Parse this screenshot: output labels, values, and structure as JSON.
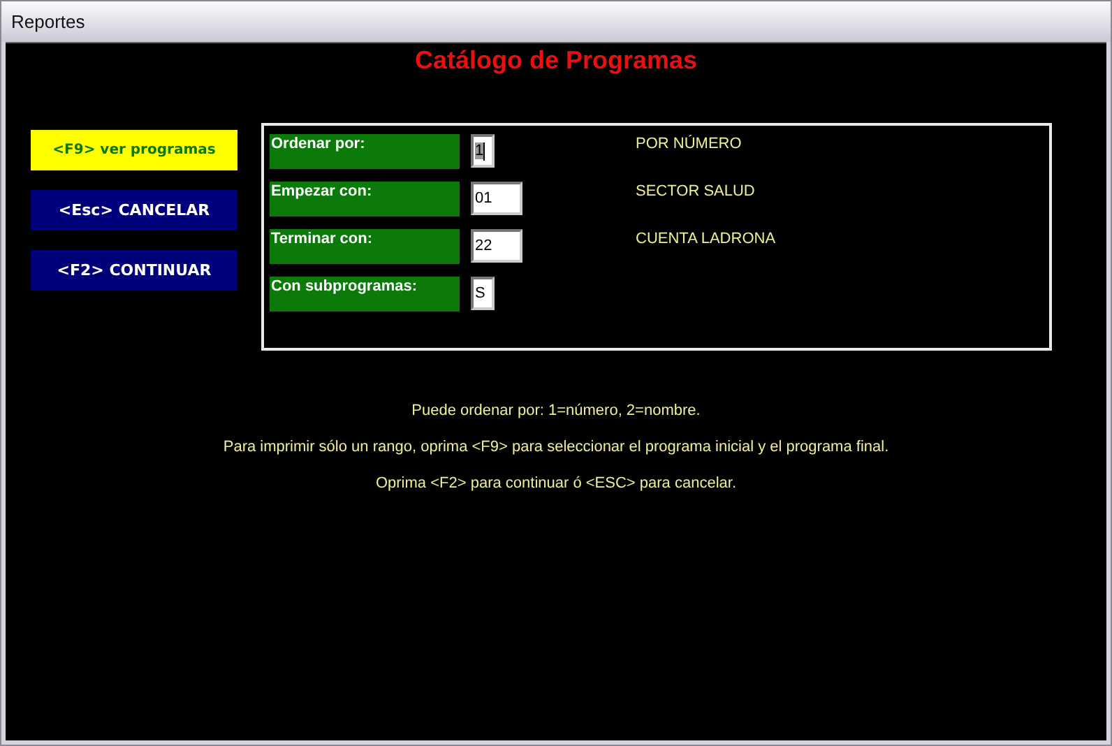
{
  "window": {
    "title": "Reportes"
  },
  "heading": "Catálogo de Programas",
  "buttons": [
    {
      "label": "<F9> ver programas",
      "selected": true
    },
    {
      "label": "<Esc> CANCELAR",
      "selected": false
    },
    {
      "label": "<F2> CONTINUAR",
      "selected": false
    }
  ],
  "form_rows": [
    {
      "label": "Ordenar por:",
      "value": "1",
      "kind": "narrow",
      "focused": true,
      "description": "POR NÚMERO"
    },
    {
      "label": "Empezar con:",
      "value": "01",
      "kind": "wide",
      "focused": false,
      "description": "SECTOR SALUD"
    },
    {
      "label": "Terminar con:",
      "value": "22",
      "kind": "wide",
      "focused": false,
      "description": "CUENTA LADRONA"
    },
    {
      "label": "Con subprogramas:",
      "value": "S",
      "kind": "narrow",
      "focused": false
    }
  ],
  "help_lines": [
    "Puede ordenar por: 1=número, 2=nombre.",
    "Para imprimir sólo un rango, oprima <F9> para seleccionar el programa inicial y el programa final.",
    "Oprima <F2> para continuar ó <ESC> para cancelar."
  ]
}
